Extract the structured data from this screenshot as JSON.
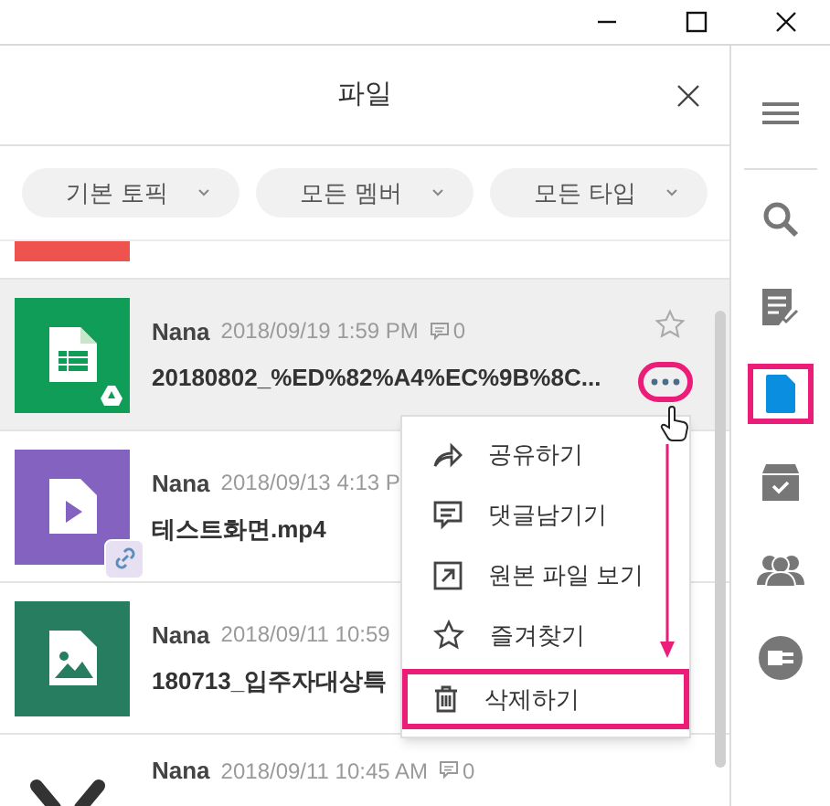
{
  "panel": {
    "title": "파일"
  },
  "filters": [
    {
      "label": "기본 토픽"
    },
    {
      "label": "모든 멤버"
    },
    {
      "label": "모든 타입"
    }
  ],
  "files": [
    {
      "kind": "partial"
    },
    {
      "kind": "sheet",
      "selected": true,
      "author": "Nana",
      "date": "2018/09/19 1:59 PM",
      "comments": "0",
      "name": "20180802_%ED%82%A4%EC%9B%8C...",
      "drive": true,
      "starred": false,
      "more": true
    },
    {
      "kind": "video",
      "selected": false,
      "author": "Nana",
      "date": "2018/09/13 4:13 P",
      "name": "테스트화면.mp4",
      "link": true
    },
    {
      "kind": "image",
      "selected": false,
      "author": "Nana",
      "date": "2018/09/11 10:59",
      "name": "180713_입주자대상특"
    },
    {
      "kind": "dark",
      "author": "Nana",
      "date": "2018/09/11 10:45 AM",
      "comments": "0"
    }
  ],
  "context_menu": [
    {
      "kind": "share",
      "label": "공유하기",
      "highlighted": false
    },
    {
      "kind": "comment",
      "label": "댓글남기기",
      "highlighted": false
    },
    {
      "kind": "open",
      "label": "원본 파일 보기",
      "highlighted": false
    },
    {
      "kind": "star",
      "label": "즐겨찾기",
      "highlighted": false
    },
    {
      "kind": "delete",
      "label": "삭제하기",
      "highlighted": true
    }
  ],
  "sidebar": [
    {
      "kind": "menu",
      "selected": false
    },
    {
      "kind": "search",
      "selected": false
    },
    {
      "kind": "tasks",
      "selected": false
    },
    {
      "kind": "file",
      "selected": true
    },
    {
      "kind": "archive",
      "selected": false
    },
    {
      "kind": "people",
      "selected": false
    },
    {
      "kind": "plug",
      "selected": false
    }
  ]
}
